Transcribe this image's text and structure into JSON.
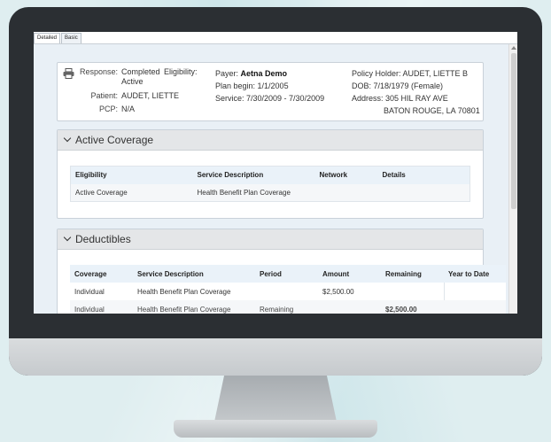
{
  "tabs": [
    {
      "label": "Detailed",
      "active": true
    },
    {
      "label": "Basic",
      "active": false
    }
  ],
  "summary": {
    "response_label": "Response:",
    "response_value": "Completed",
    "eligibility_label": "Eligibility:",
    "eligibility_value": "Active",
    "patient_label": "Patient:",
    "patient_value": "AUDET, LIETTE",
    "pcp_label": "PCP:",
    "pcp_value": "N/A",
    "payer_label": "Payer:",
    "payer_value": "Aetna Demo",
    "plan_begin": "Plan begin: 1/1/2005",
    "service": "Service: 7/30/2009 - 7/30/2009",
    "policy_holder": "Policy Holder: AUDET, LIETTE B",
    "dob": "DOB: 7/18/1979 (Female)",
    "address_line1": "Address: 305 HIL RAY AVE",
    "address_line2": "BATON ROUGE, LA 70801"
  },
  "active_coverage": {
    "title": "Active Coverage",
    "columns": [
      "Eligibility",
      "Service Description",
      "Network",
      "Details"
    ],
    "rows": [
      [
        "Active Coverage",
        "Health Benefit Plan Coverage",
        "",
        ""
      ]
    ]
  },
  "deductibles": {
    "title": "Deductibles",
    "columns": [
      "Coverage",
      "Service Description",
      "Period",
      "Amount",
      "Remaining",
      "Year to Date"
    ],
    "rows": [
      [
        "Individual",
        "Health Benefit Plan Coverage",
        "",
        "$2,500.00",
        "",
        ""
      ],
      [
        "Individual",
        "Health Benefit Plan Coverage",
        "Remaining",
        "",
        "$2,500.00",
        ""
      ]
    ]
  },
  "colors": {
    "bezel": "#2b2f33",
    "content_bg": "#e9f0f6",
    "header_bg": "#e4e6e8"
  }
}
